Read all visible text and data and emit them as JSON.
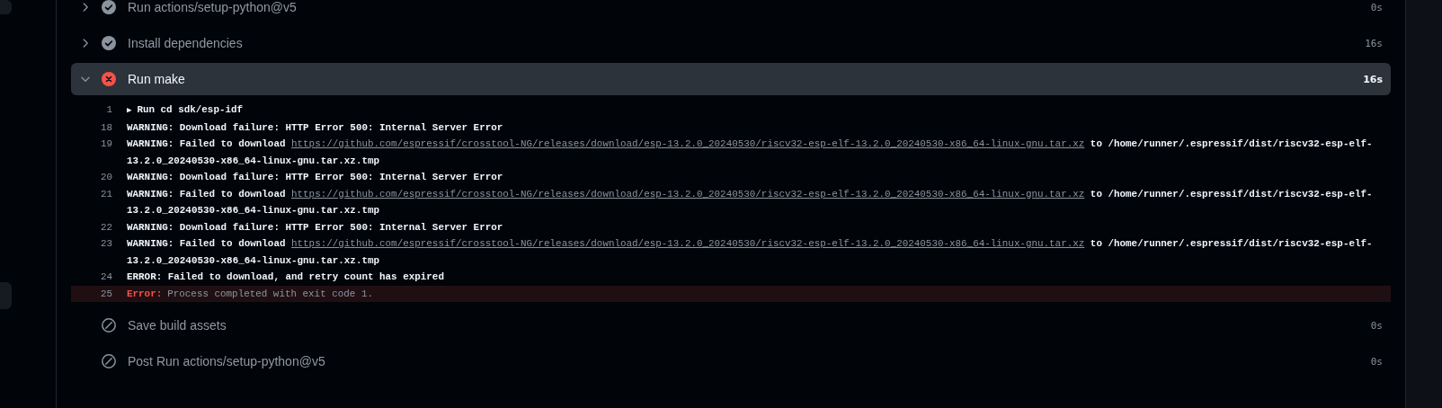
{
  "steps": [
    {
      "name": "Run actions/setup-python@v5",
      "kind": "success",
      "expanded": false,
      "duration": "0s"
    },
    {
      "name": "Install dependencies",
      "kind": "success",
      "expanded": false,
      "duration": "16s"
    },
    {
      "name": "Run make",
      "kind": "failure",
      "expanded": true,
      "duration": "16s",
      "log": [
        {
          "number": "1",
          "kind": "command",
          "marker": "▶",
          "text": "Run cd sdk/esp-idf"
        },
        {
          "number": "18",
          "kind": "plain",
          "text": "WARNING: Download failure: HTTP Error 500: Internal Server Error"
        },
        {
          "number": "19",
          "kind": "plain",
          "text": "WARNING: Failed to download",
          "link": "https://github.com/espressif/crosstool-NG/releases/download/esp-13.2.0_20240530/riscv32-esp-elf-13.2.0_20240530-x86_64-linux-gnu.tar.xz",
          "after": "to /home/runner/.espressif/dist/riscv32-esp-elf-13.2.0_20240530-x86_64-linux-gnu.tar.xz.tmp"
        },
        {
          "number": "20",
          "kind": "plain",
          "text": "WARNING: Download failure: HTTP Error 500: Internal Server Error"
        },
        {
          "number": "21",
          "kind": "plain",
          "text": "WARNING: Failed to download",
          "link": "https://github.com/espressif/crosstool-NG/releases/download/esp-13.2.0_20240530/riscv32-esp-elf-13.2.0_20240530-x86_64-linux-gnu.tar.xz",
          "after": "to /home/runner/.espressif/dist/riscv32-esp-elf-13.2.0_20240530-x86_64-linux-gnu.tar.xz.tmp"
        },
        {
          "number": "22",
          "kind": "plain",
          "text": "WARNING: Download failure: HTTP Error 500: Internal Server Error"
        },
        {
          "number": "23",
          "kind": "plain",
          "text": "WARNING: Failed to download",
          "link": "https://github.com/espressif/crosstool-NG/releases/download/esp-13.2.0_20240530/riscv32-esp-elf-13.2.0_20240530-x86_64-linux-gnu.tar.xz",
          "after": "to /home/runner/.espressif/dist/riscv32-esp-elf-13.2.0_20240530-x86_64-linux-gnu.tar.xz.tmp"
        },
        {
          "number": "24",
          "kind": "plain",
          "text": "ERROR: Failed to download, and retry count has expired"
        },
        {
          "number": "25",
          "kind": "error",
          "label": "Error:",
          "text": "Process completed with exit code 1."
        }
      ]
    },
    {
      "name": "Save build assets",
      "kind": "skipped",
      "expanded": false,
      "duration": "0s"
    },
    {
      "name": "Post Run actions/setup-python@v5",
      "kind": "skipped",
      "expanded": false,
      "duration": "0s"
    }
  ]
}
